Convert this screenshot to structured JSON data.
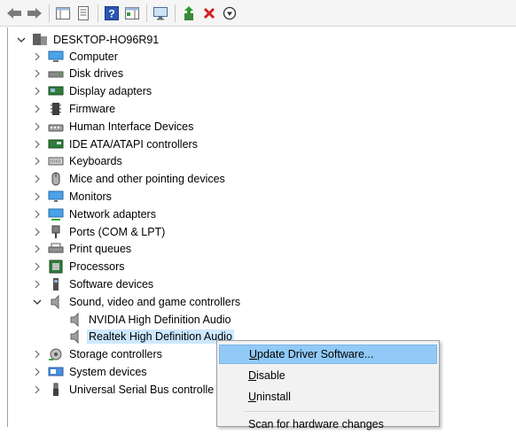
{
  "toolbar": {
    "buttons": [
      {
        "name": "back-button",
        "icon": "back-arrow-icon"
      },
      {
        "name": "forward-button",
        "icon": "forward-arrow-icon"
      },
      {
        "name": "show-hide-console-tree-button",
        "icon": "console-tree-icon"
      },
      {
        "name": "properties-button",
        "icon": "properties-icon"
      },
      {
        "name": "help-button",
        "icon": "help-icon"
      },
      {
        "name": "action-pane-button",
        "icon": "action-pane-icon"
      },
      {
        "name": "scan-hardware-button",
        "icon": "monitor-scan-icon"
      },
      {
        "name": "update-driver-button",
        "icon": "update-driver-icon"
      },
      {
        "name": "uninstall-button",
        "icon": "red-x-icon"
      },
      {
        "name": "disable-button",
        "icon": "down-arrow-circle-icon"
      }
    ]
  },
  "tree": {
    "root": "DESKTOP-HO96R91",
    "categories": [
      "Computer",
      "Disk drives",
      "Display adapters",
      "Firmware",
      "Human Interface Devices",
      "IDE ATA/ATAPI controllers",
      "Keyboards",
      "Mice and other pointing devices",
      "Monitors",
      "Network adapters",
      "Ports (COM & LPT)",
      "Print queues",
      "Processors",
      "Software devices",
      "Sound, video and game controllers"
    ],
    "sound_children": [
      "NVIDIA High Definition Audio",
      "Realtek High Definition Audio"
    ],
    "after": [
      "Storage controllers",
      "System devices",
      "Universal Serial Bus controlle"
    ]
  },
  "context_menu": {
    "update_pre": "",
    "update_key": "U",
    "update_post": "pdate Driver Software...",
    "disable_key": "D",
    "disable_post": "isable",
    "uninstall_key": "U",
    "uninstall_post": "ninstall",
    "scan": "Scan for hardware changes"
  },
  "colors": {
    "selection": "#cce8ff",
    "menu_hover": "#91c9f7",
    "accent": "#1e73be"
  }
}
